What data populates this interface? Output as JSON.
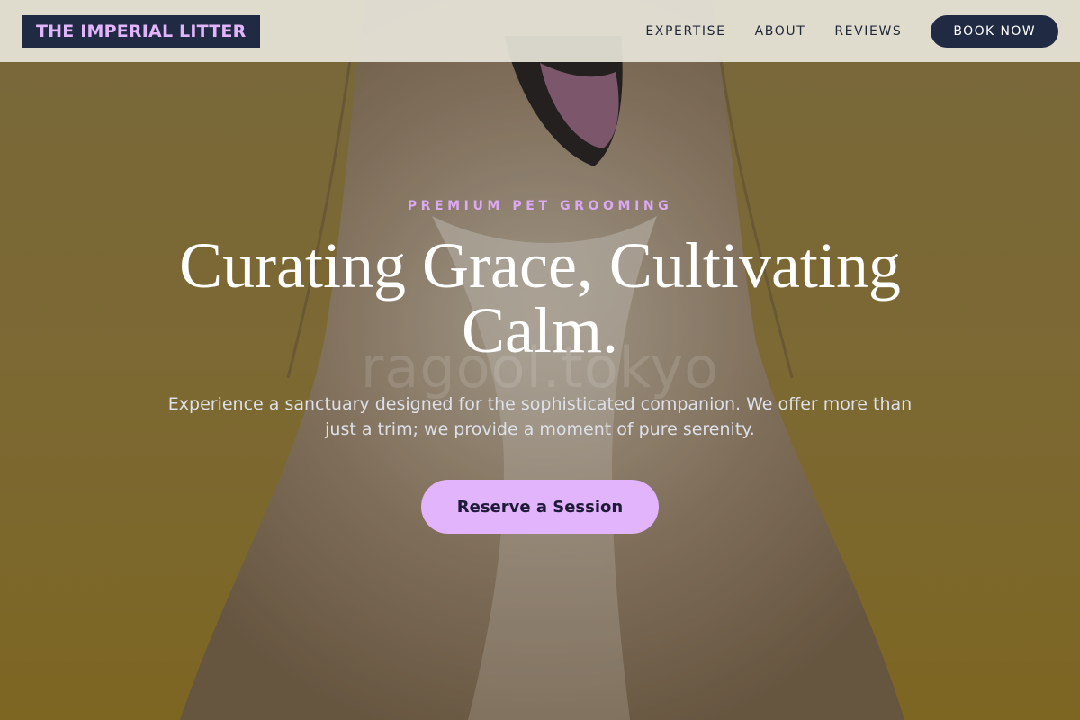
{
  "brand": {
    "logo_text": "THE IMPERIAL LITTER"
  },
  "nav": {
    "links": [
      "EXPERTISE",
      "ABOUT",
      "REVIEWS"
    ],
    "cta_label": "BOOK NOW"
  },
  "hero": {
    "eyebrow": "PREMIUM PET GROOMING",
    "headline": "Curating Grace, Cultivating Calm.",
    "subtext": "Experience a sanctuary designed for the sophisticated companion. We offer more than just a trim; we provide a moment of pure serenity.",
    "cta_label": "Reserve a Session",
    "watermark": "ragool.tokyo",
    "image_subject": "long-haired dog on mustard backdrop"
  },
  "colors": {
    "navy": "#202b43",
    "lavender": "#e2b4fb",
    "backdrop": "#8a7435"
  }
}
